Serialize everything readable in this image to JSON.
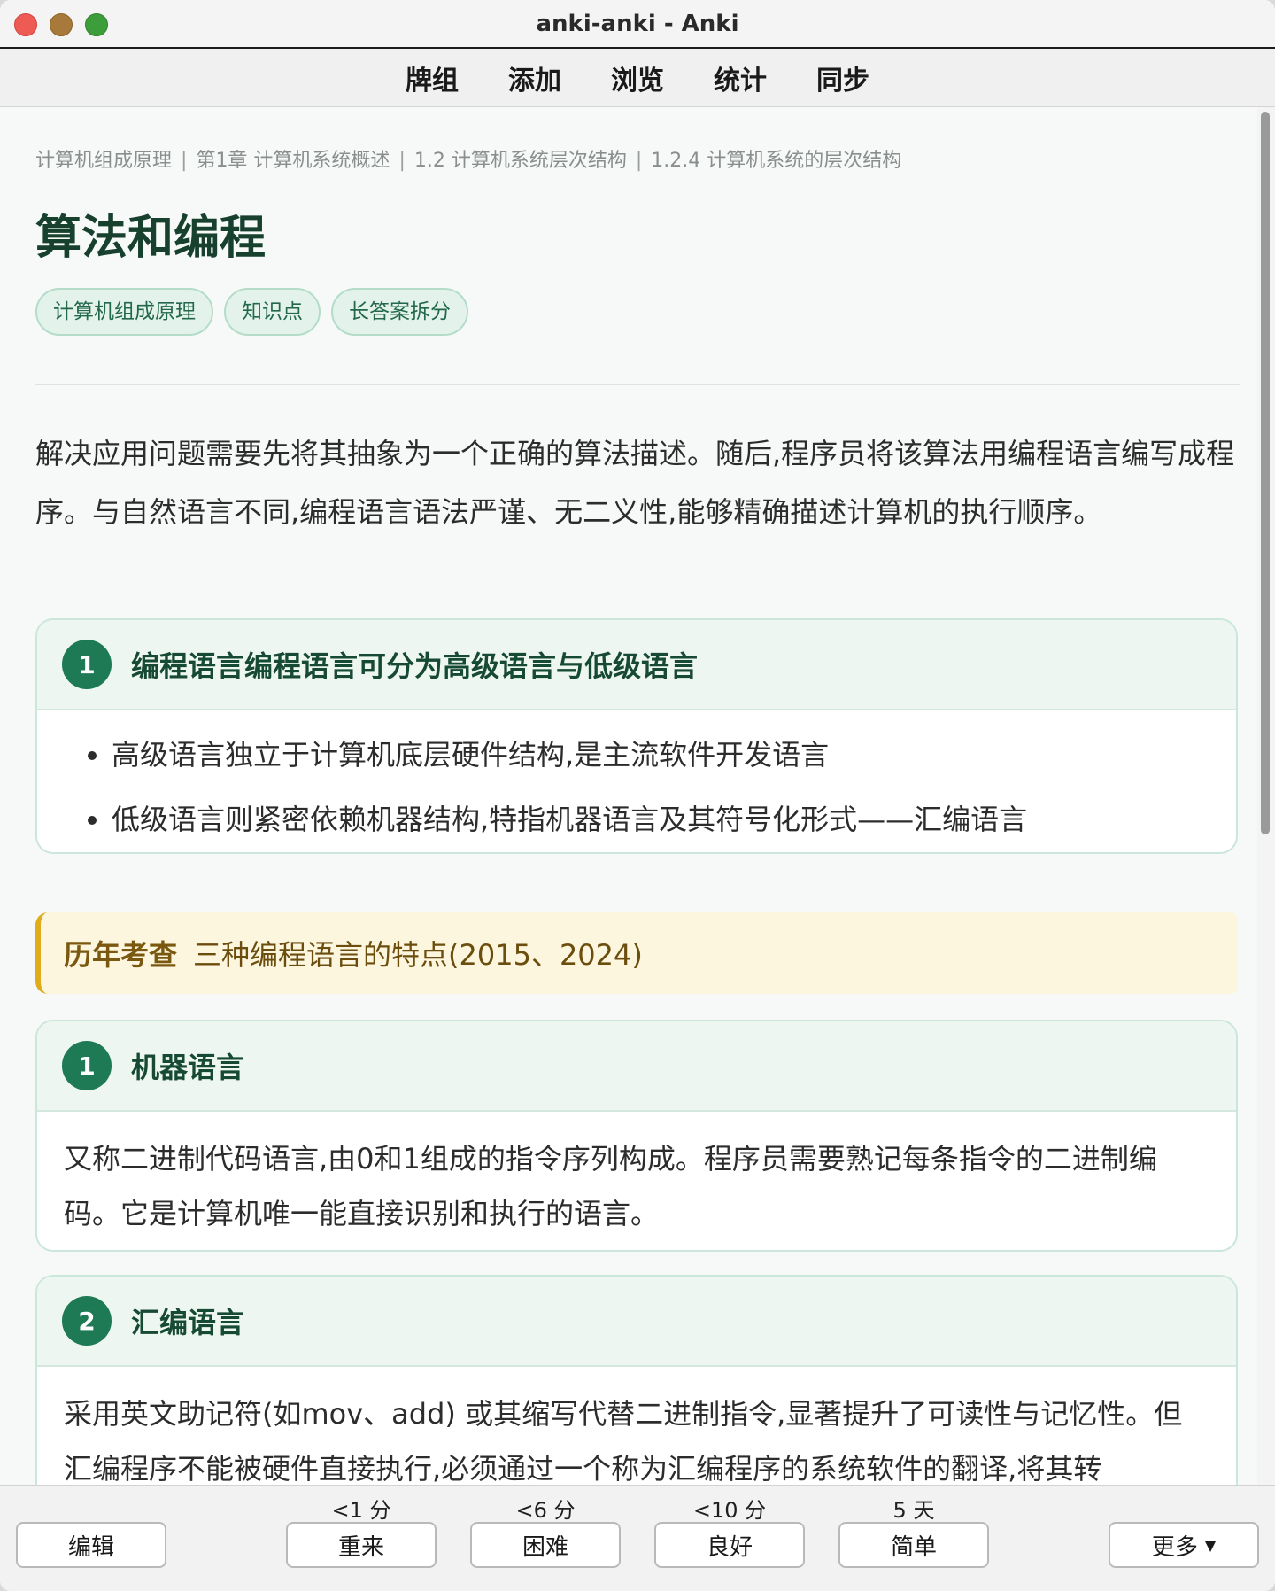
{
  "window": {
    "title": "anki-anki - Anki"
  },
  "toolbar": {
    "items": [
      "牌组",
      "添加",
      "浏览",
      "统计",
      "同步"
    ]
  },
  "breadcrumb": [
    "计算机组成原理",
    "第1章 计算机系统概述",
    "1.2 计算机系统层次结构",
    "1.2.4 计算机系统的层次结构"
  ],
  "card": {
    "title": "算法和编程",
    "tags": [
      "计算机组成原理",
      "知识点",
      "长答案拆分"
    ],
    "intro": "解决应用问题需要先将其抽象为一个正确的算法描述。随后,程序员将该算法用编程语言编写成程序。与自然语言不同,编程语言语法严谨、无二义性,能够精确描述计算机的执行顺序。",
    "section1": {
      "number": "1",
      "title": "编程语言编程语言可分为高级语言与低级语言",
      "bullets": [
        "高级语言独立于计算机底层硬件结构,是主流软件开发语言",
        "低级语言则紧密依赖机器结构,特指机器语言及其符号化形式——汇编语言"
      ]
    },
    "exam": {
      "label": "历年考查",
      "text": "三种编程语言的特点(2015、2024)"
    },
    "section2": {
      "number": "1",
      "title": "机器语言",
      "text": "又称二进制代码语言,由0和1组成的指令序列构成。程序员需要熟记每条指令的二进制编码。它是计算机唯一能直接识别和执行的语言。"
    },
    "section3": {
      "number": "2",
      "title": "汇编语言",
      "text": "采用英文助记符(如mov、add) 或其缩写代替二进制指令,显著提升了可读性与记忆性。但汇编程序不能被硬件直接执行,必须通过一个称为汇编程序的系统软件的翻译,将其转"
    }
  },
  "bottom": {
    "edit": "编辑",
    "more": "更多",
    "answers": [
      {
        "interval": "<1 分",
        "label": "重来"
      },
      {
        "interval": "<6 分",
        "label": "困难"
      },
      {
        "interval": "<10 分",
        "label": "良好"
      },
      {
        "interval": "5 天",
        "label": "简单"
      }
    ]
  }
}
